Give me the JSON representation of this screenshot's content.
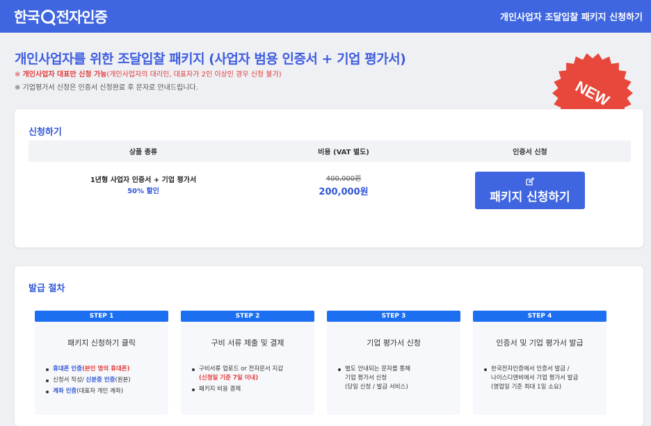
{
  "header": {
    "logo_text_left": "한국",
    "logo_text_right": "전자인증",
    "title": "개인사업자 조달입찰 패키지 신청하기"
  },
  "intro": {
    "heading": "개인사업자를 위한 조달입찰 패키지 (사업자 범용 인증서 + 기업 평가서)",
    "notice1_prefix": "※ ",
    "notice1_strong": "개인사업자 대표만 신청 가능",
    "notice1_rest": "(개인사업자의 대리인, 대표자가 2인 이상인 경우 신청 불가)",
    "notice2": "※ 기업평가서 신청은 인증서 신청완료 후 문자로 안내드립니다.",
    "badge": "NEW"
  },
  "apply": {
    "section_title": "신청하기",
    "columns": [
      "상품 종류",
      "비용 (VAT 별도)",
      "인증서 신청"
    ],
    "product": "1년형 사업자 인증서 + 기업 평가서",
    "discount": "50% 할인",
    "price_old": "400,000원",
    "price_new": "200,000원",
    "button_label": "패키지 신청하기",
    "button_icon": "edit-icon"
  },
  "procedure": {
    "section_title": "발급 절차",
    "steps": [
      {
        "tag": "STEP 1",
        "title": "패키지 신청하기 클릭",
        "items": [
          [
            {
              "t": "휴대폰 인증",
              "c": "blue"
            },
            {
              "t": "(본인 명의 휴대폰)",
              "c": "red"
            }
          ],
          [
            {
              "t": "신청서 작성/ ",
              "c": "gray"
            },
            {
              "t": "신분증 인증",
              "c": "blue"
            },
            {
              "t": "(원본)",
              "c": "gray"
            }
          ],
          [
            {
              "t": "계좌 인증",
              "c": "blue"
            },
            {
              "t": "(대표자 개인 계좌)",
              "c": "gray"
            }
          ]
        ]
      },
      {
        "tag": "STEP 2",
        "title": "구비 서류 제출 및 결제",
        "items": [
          [
            {
              "t": "구비서류 업로드 or 전자문서 지갑",
              "c": "gray"
            },
            {
              "t": "(신청일 기준 7일 이내)",
              "c": "red",
              "br": true
            }
          ],
          [
            {
              "t": "패키지 비용 결제",
              "c": "gray"
            }
          ]
        ]
      },
      {
        "tag": "STEP 3",
        "title": "기업 평가서 신청",
        "items": [
          [
            {
              "t": "별도 안내되는 문자를 통해",
              "c": "gray"
            },
            {
              "t": "기업 평가서 신청",
              "c": "gray",
              "br": true
            },
            {
              "t": "(당일 신청 / 발급 서비스)",
              "c": "gray",
              "br": true
            }
          ]
        ]
      },
      {
        "tag": "STEP 4",
        "title": "인증서 및 기업 평가서 발급",
        "items": [
          [
            {
              "t": "한국전자인증에서 인증서 발급 /",
              "c": "gray"
            },
            {
              "t": "나이스디앤비에서 기업 평가서 발급",
              "c": "gray",
              "br": true
            },
            {
              "t": "(영업일 기준 최대 1일 소요)",
              "c": "gray",
              "br": true
            }
          ]
        ]
      }
    ]
  }
}
